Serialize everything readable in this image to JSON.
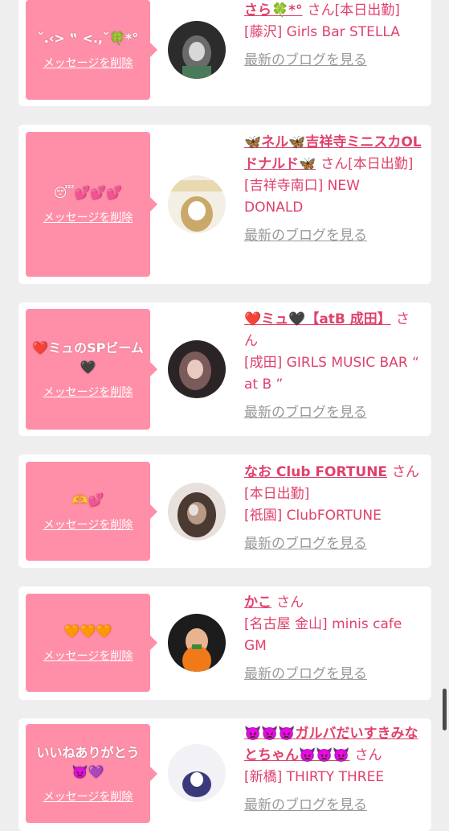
{
  "delete_label": "メッセージを削除",
  "blog_label": "最新のブログを見る",
  "san_label": "さん",
  "cards": [
    {
      "bubble_text": "ˇ.‹> ‟ <.,ˇ🍀*°",
      "name": "さら🍀*°",
      "status": "[本日出勤]",
      "shop": "[藤沢] Girls Bar STELLA",
      "avatar_icon": "girl-photo-icon",
      "avatar_colors": [
        "#2c2c2c",
        "#6b6b6b",
        "#d8d8d8"
      ]
    },
    {
      "bubble_text": "😴💕💕💕",
      "name": "🦋ネル🦋吉祥寺ミニスカOLドナルド🦋",
      "status": "[本日出勤]",
      "shop": "[吉祥寺南口] NEW DONALD",
      "avatar_icon": "girl-photo-icon",
      "avatar_colors": [
        "#e8d9b0",
        "#c9a86a",
        "#ffffff"
      ]
    },
    {
      "bubble_text": "❤️ミュのSPビーム🖤",
      "name": "❤️ミュ🖤【atB 成田】",
      "status": "",
      "shop": "[成田] GIRLS MUSIC BAR “ at B ”",
      "avatar_icon": "girl-photo-icon",
      "avatar_colors": [
        "#2a2426",
        "#7b5a5a",
        "#e9c9c0"
      ]
    },
    {
      "bubble_text": "🫶💕",
      "name": "なお Club FORTUNE",
      "status": "[本日出勤]",
      "shop": "[祇園] ClubFORTUNE",
      "avatar_icon": "girl-photo-icon",
      "avatar_colors": [
        "#b89a86",
        "#4a3a32",
        "#e8e0dc"
      ]
    },
    {
      "bubble_text": "🧡🧡🧡",
      "name": "かこ",
      "status": "",
      "shop": "[名古屋 金山] minis cafe GM",
      "avatar_icon": "girl-photo-icon",
      "avatar_colors": [
        "#1c1c1c",
        "#e8b38f",
        "#f07a1a"
      ]
    },
    {
      "bubble_text": "いいねありがとう👿💜",
      "name": "👿👿👿ガルバだいすきみなとちゃん👿👿👿",
      "status": "",
      "shop": "[新橋] THIRTY THREE",
      "avatar_icon": "girl-photo-icon",
      "avatar_colors": [
        "#f2f2f6",
        "#3a3a7a",
        "#ffffff"
      ]
    }
  ]
}
